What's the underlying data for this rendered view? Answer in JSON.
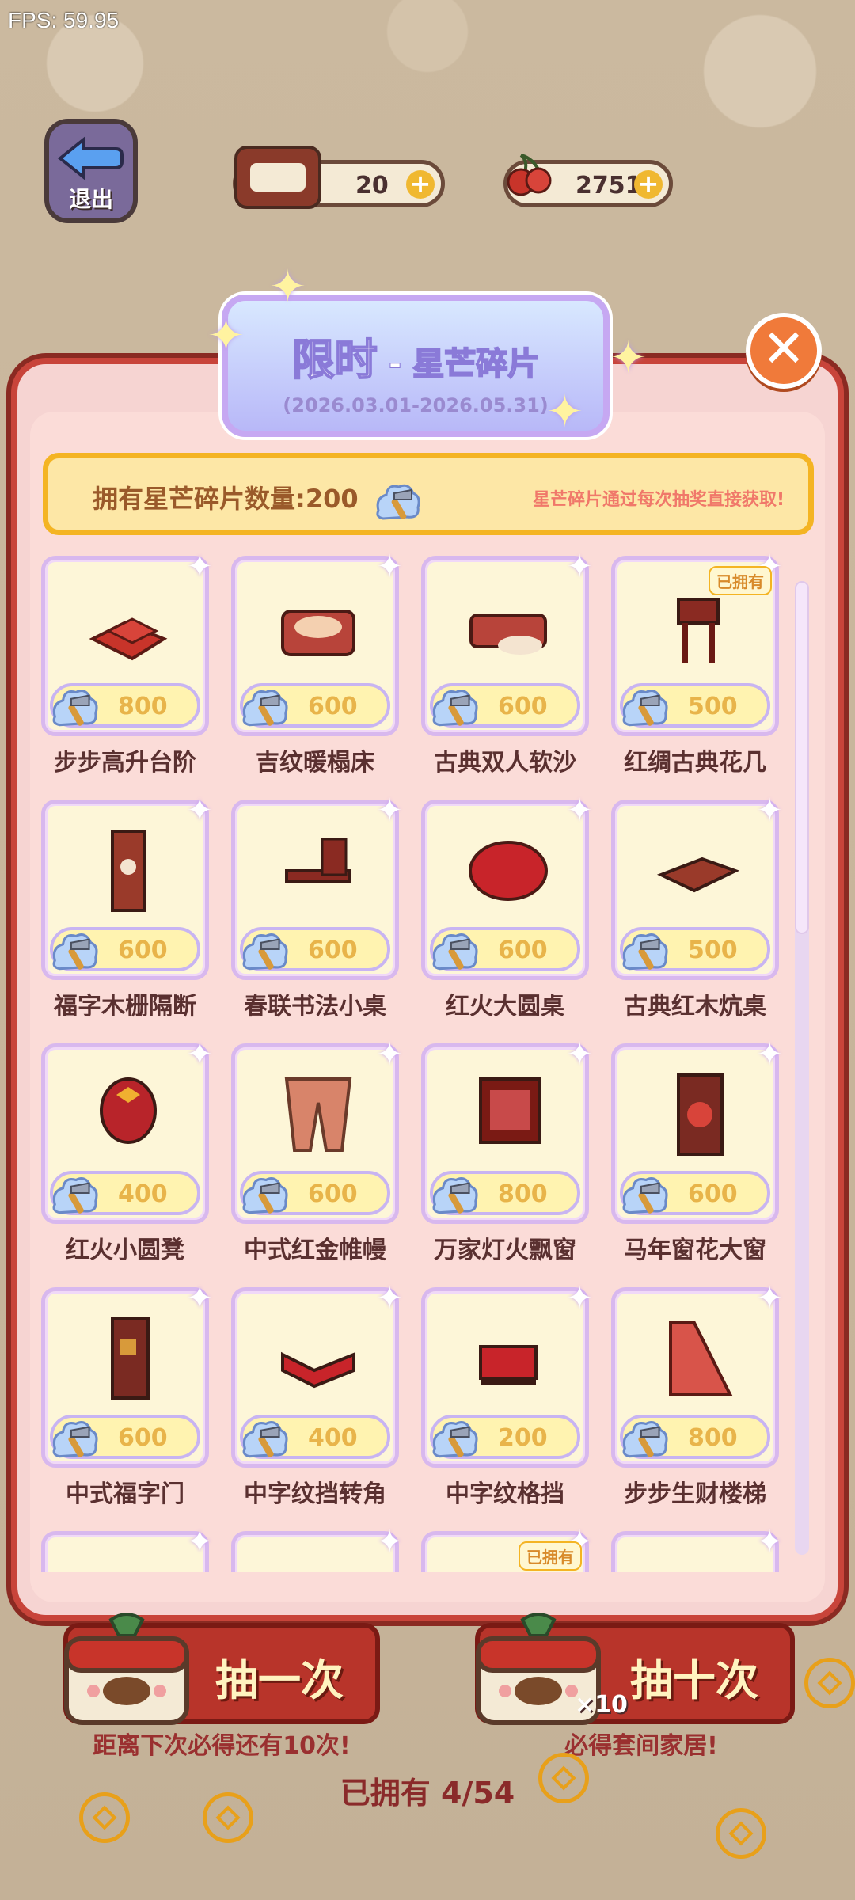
{
  "fps": "FPS: 59.95",
  "exit_label": "退出",
  "resources": {
    "tickets": "20",
    "cherries": "2751",
    "plus": "+"
  },
  "banner": {
    "title": "限时",
    "dash": "-",
    "subtitle": "星芒碎片",
    "date_range": "(2026.03.01-2026.05.31)"
  },
  "close_symbol": "✕",
  "owned_bar": {
    "label": "拥有星芒碎片数量:",
    "count": "200",
    "note": "星芒碎片通过每次抽奖直接获取!"
  },
  "owned_tag": "已拥有",
  "items": [
    {
      "name": "步步高升台阶",
      "price": "800",
      "owned": false
    },
    {
      "name": "吉纹暖榻床",
      "price": "600",
      "owned": false
    },
    {
      "name": "古典双人软沙",
      "price": "600",
      "owned": false
    },
    {
      "name": "红绸古典花几",
      "price": "500",
      "owned": true
    },
    {
      "name": "福字木栅隔断",
      "price": "600",
      "owned": false
    },
    {
      "name": "春联书法小桌",
      "price": "600",
      "owned": false
    },
    {
      "name": "红火大圆桌",
      "price": "600",
      "owned": false
    },
    {
      "name": "古典红木炕桌",
      "price": "500",
      "owned": false
    },
    {
      "name": "红火小圆凳",
      "price": "400",
      "owned": false
    },
    {
      "name": "中式红金帷幔",
      "price": "600",
      "owned": false
    },
    {
      "name": "万家灯火飘窗",
      "price": "800",
      "owned": false
    },
    {
      "name": "马年窗花大窗",
      "price": "600",
      "owned": false
    },
    {
      "name": "中式福字门",
      "price": "600",
      "owned": false
    },
    {
      "name": "中字纹挡转角",
      "price": "400",
      "owned": false
    },
    {
      "name": "中字纹格挡",
      "price": "200",
      "owned": false
    },
    {
      "name": "步步生财楼梯",
      "price": "800",
      "owned": false
    }
  ],
  "draw": {
    "once_label": "抽一次",
    "ten_label": "抽十次",
    "ten_badge": "×10",
    "once_note": "距离下次必得还有10次!",
    "ten_note": "必得套间家居!"
  },
  "collection": "已拥有 4/54",
  "colors": {
    "accent_red": "#b8342a",
    "gold": "#f4b423",
    "card_bg": "#fdf6d8",
    "price_text": "#e8b44a"
  }
}
